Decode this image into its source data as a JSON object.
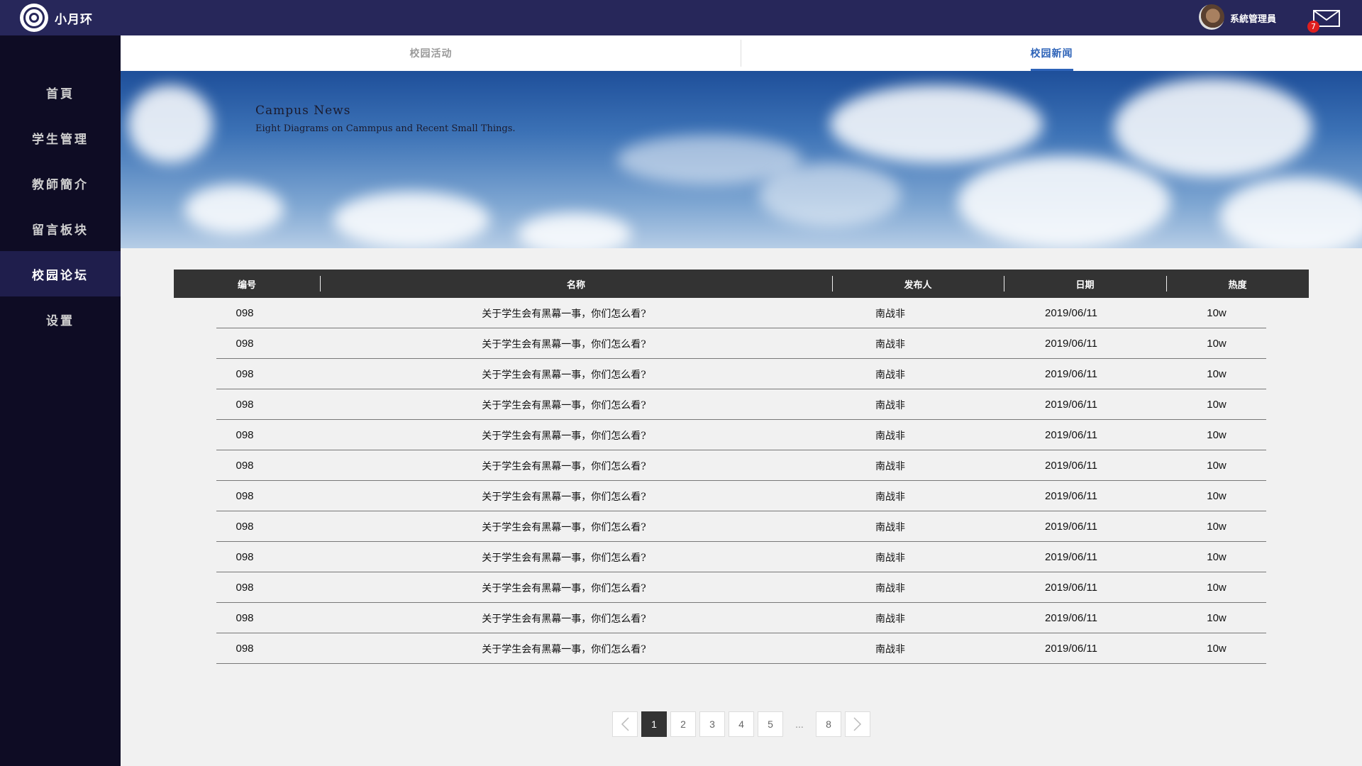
{
  "app": {
    "brand": "小月环",
    "user_name": "系統管理員",
    "unread_count": "7"
  },
  "sidebar": {
    "items": [
      "首頁",
      "学生管理",
      "教師簡介",
      "留言板块",
      "校园论坛",
      "设置"
    ],
    "active_index": 4
  },
  "tabs": {
    "items": [
      "校园活动",
      "校园新闻"
    ],
    "active_index": 1
  },
  "banner": {
    "title": "Campus News",
    "subtitle": "Eight Diagrams on Cammpus and Recent Small Things."
  },
  "table": {
    "headers": [
      "编号",
      "名称",
      "发布人",
      "日期",
      "热度"
    ],
    "rows": [
      [
        "098",
        "关于学生会有黑幕一事，你们怎么看?",
        "南战非",
        "2019/06/11",
        "10w"
      ],
      [
        "098",
        "关于学生会有黑幕一事，你们怎么看?",
        "南战非",
        "2019/06/11",
        "10w"
      ],
      [
        "098",
        "关于学生会有黑幕一事，你们怎么看?",
        "南战非",
        "2019/06/11",
        "10w"
      ],
      [
        "098",
        "关于学生会有黑幕一事，你们怎么看?",
        "南战非",
        "2019/06/11",
        "10w"
      ],
      [
        "098",
        "关于学生会有黑幕一事，你们怎么看?",
        "南战非",
        "2019/06/11",
        "10w"
      ],
      [
        "098",
        "关于学生会有黑幕一事，你们怎么看?",
        "南战非",
        "2019/06/11",
        "10w"
      ],
      [
        "098",
        "关于学生会有黑幕一事，你们怎么看?",
        "南战非",
        "2019/06/11",
        "10w"
      ],
      [
        "098",
        "关于学生会有黑幕一事，你们怎么看?",
        "南战非",
        "2019/06/11",
        "10w"
      ],
      [
        "098",
        "关于学生会有黑幕一事，你们怎么看?",
        "南战非",
        "2019/06/11",
        "10w"
      ],
      [
        "098",
        "关于学生会有黑幕一事，你们怎么看?",
        "南战非",
        "2019/06/11",
        "10w"
      ],
      [
        "098",
        "关于学生会有黑幕一事，你们怎么看?",
        "南战非",
        "2019/06/11",
        "10w"
      ],
      [
        "098",
        "关于学生会有黑幕一事，你们怎么看?",
        "南战非",
        "2019/06/11",
        "10w"
      ]
    ]
  },
  "pagination": {
    "pages": [
      "1",
      "2",
      "3",
      "4",
      "5",
      "...",
      "8"
    ],
    "current": "1"
  },
  "icons": {
    "logo": "logo-icon",
    "avatar": "avatar",
    "mail": "mail-icon",
    "prev": "chevron-left-icon",
    "next": "chevron-right-icon"
  },
  "colors": {
    "topbar": "#27275a",
    "sidebar": "#0e0c24",
    "sidebar_active": "#1f1e4c",
    "tab_active": "#2d63b8",
    "header": "#333333",
    "badge": "#e01e1e"
  }
}
